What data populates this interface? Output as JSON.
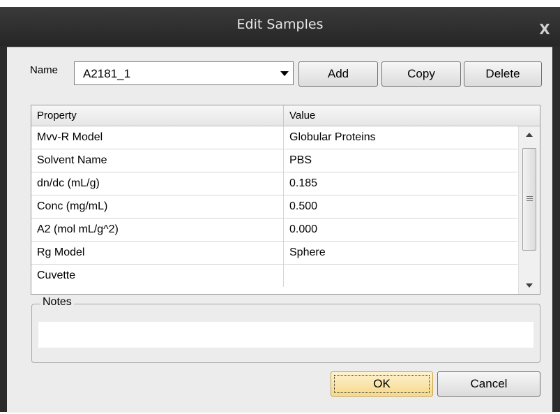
{
  "window": {
    "title": "Edit Samples",
    "close_glyph": "X"
  },
  "name_row": {
    "label": "Name",
    "selected": "A2181_1",
    "buttons": {
      "add": "Add",
      "copy": "Copy",
      "delete": "Delete"
    }
  },
  "grid": {
    "headers": {
      "property": "Property",
      "value": "Value"
    },
    "rows": [
      {
        "property": "Mvv-R Model",
        "value": "Globular Proteins"
      },
      {
        "property": "Solvent Name",
        "value": "PBS"
      },
      {
        "property": "dn/dc (mL/g)",
        "value": "0.185"
      },
      {
        "property": "Conc (mg/mL)",
        "value": "0.500"
      },
      {
        "property": "A2 (mol mL/g^2)",
        "value": "0.000"
      },
      {
        "property": "Rg Model",
        "value": "Sphere"
      },
      {
        "property": "Cuvette",
        "value": ""
      }
    ]
  },
  "notes": {
    "label": "Notes",
    "value": ""
  },
  "footer": {
    "ok": "OK",
    "cancel": "Cancel"
  },
  "colors": {
    "title_bar": "#2b2b2b",
    "dialog_bg": "#ececec",
    "ok_highlight": "#f6d98a"
  }
}
